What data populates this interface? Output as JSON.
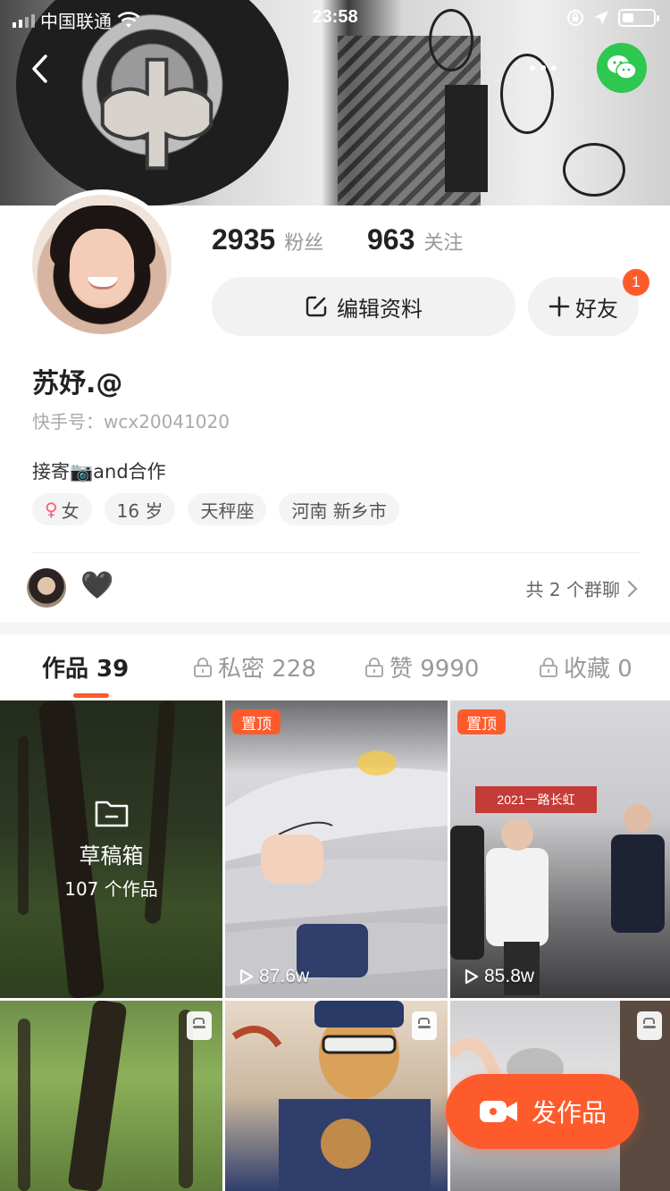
{
  "status_bar": {
    "carrier": "中国联通",
    "time": "23:58"
  },
  "stats": {
    "followers_count": "2935",
    "followers_label": "粉丝",
    "following_count": "963",
    "following_label": "关注"
  },
  "actions": {
    "edit_profile": "编辑资料",
    "add_friend": "好友",
    "friend_badge": "1"
  },
  "profile": {
    "username": "苏妤.@",
    "kuaishou_id": "快手号：wcx20041020",
    "bio_prefix": "接寄",
    "bio_suffix": "and合作",
    "tags": {
      "gender": "女",
      "age": "16 岁",
      "zodiac": "天秤座",
      "location": "河南 新乡市"
    }
  },
  "group_chat": {
    "emoji": "🖤",
    "link_label": "共 2 个群聊"
  },
  "tabs": [
    {
      "label": "作品 39"
    },
    {
      "label": "私密 228"
    },
    {
      "label": "赞 9990"
    },
    {
      "label": "收藏 0"
    }
  ],
  "grid": {
    "drafts": {
      "title": "草稿箱",
      "count": "107 个作品"
    },
    "pin_label": "置顶",
    "videos": [
      {
        "views": "87.6w"
      },
      {
        "views": "85.8w"
      }
    ],
    "banner_text": "2021一路长虹"
  },
  "fab": {
    "label": "发作品"
  },
  "colors": {
    "accent": "#fe5b2c",
    "wechat": "#2ec750"
  }
}
